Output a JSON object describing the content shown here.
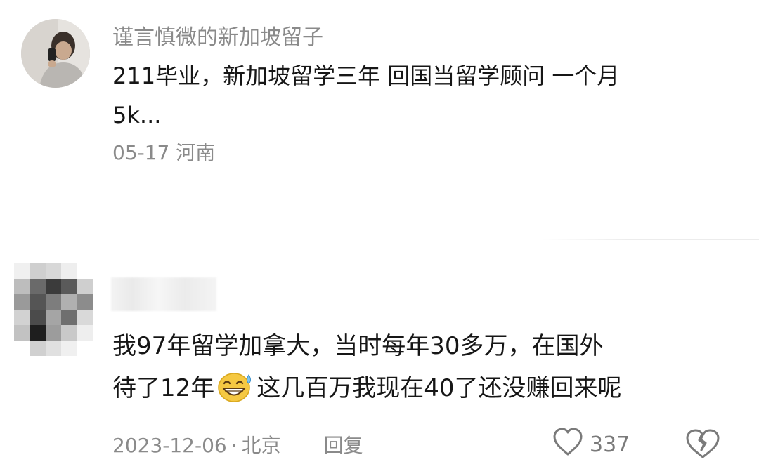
{
  "comments": [
    {
      "user": "谨言慎微的新加坡留子",
      "text_lines": [
        "211毕业，新加坡留学三年 回国当留学顾问 一个月",
        "5k..."
      ],
      "date": "05-17",
      "location": "河南"
    },
    {
      "user": "",
      "text_lines": [
        "我97年留学加拿大，当时每年30多万，在国外",
        "待了12年",
        "这几百万我现在40了还没赚回来呢"
      ],
      "emoji": "sweat-smile-emoji",
      "date": "2023-12-06",
      "separator": "·",
      "location": "北京",
      "reply_label": "回复",
      "like_count": "337"
    }
  ],
  "icons": {
    "like": "heart-outline-icon",
    "dislike": "broken-heart-icon"
  },
  "colors": {
    "text": "#161616",
    "meta": "#8a8a8a",
    "icon": "#7a7a7a",
    "emoji": "#f5c842"
  }
}
